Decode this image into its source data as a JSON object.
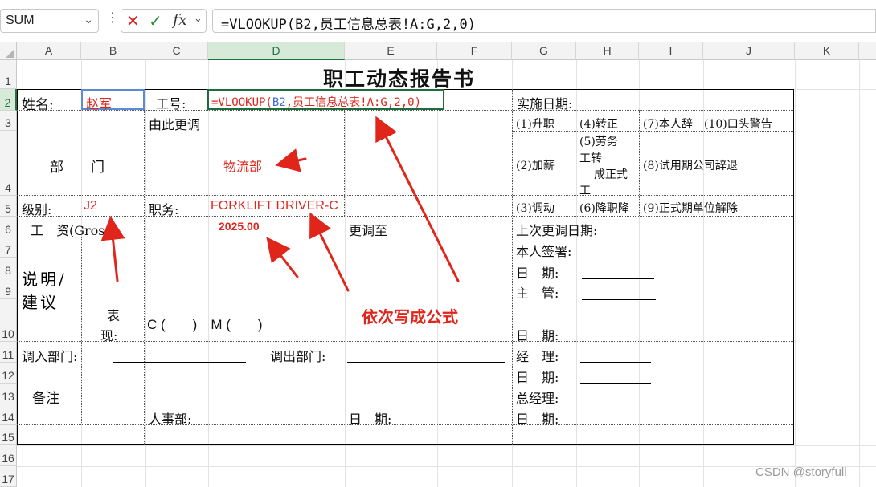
{
  "formula_bar": {
    "name_box": "SUM",
    "cancel_icon": "✕",
    "confirm_icon": "✓",
    "fx_label": "fx",
    "formula": "=VLOOKUP(B2,员工信息总表!A:G,2,0)"
  },
  "columns": [
    "A",
    "B",
    "C",
    "D",
    "E",
    "F",
    "G",
    "H",
    "I",
    "J",
    "K"
  ],
  "rows": [
    "1",
    "2",
    "3",
    "4",
    "5",
    "6",
    "7",
    "8",
    "9",
    "10",
    "11",
    "12",
    "13",
    "14",
    "15",
    "16",
    "17"
  ],
  "sheet": {
    "title": "职工动态报告书",
    "name_label": "姓名:",
    "name_value": "赵军",
    "id_label": "工号:",
    "cell_formula_prefix": "=VLOOKUP(",
    "cell_formula_ref": "B2",
    "cell_formula_rest": ",员工信息总表!A:G,2,0)",
    "effective_date": "实施日期:",
    "change_from": "由此更调",
    "dept_label": "部　　门",
    "dept_value": "物流部",
    "level_label": "级别:",
    "level_value": "J2",
    "position_label": "职务:",
    "position_value": "FORKLIFT DRIVER-C",
    "salary_label": "工　资(Gross)",
    "salary_value": "2025.00",
    "change_to": "更调至",
    "last_change": "上次更调日期:",
    "option1": "(1)升职",
    "option2": "(2)加薪",
    "option3": "(3)调动",
    "option4": "(4)转正",
    "option5a": "(5)劳务",
    "option5b": "工转",
    "option5c": "成正式",
    "option5d": "工",
    "option6": "(6)降职降",
    "option7": "(7)本人辞",
    "option8": "(8)试用期公司辞退",
    "option9": "(9)正式期单位解除",
    "option10": "(10)口头警告",
    "remark_label": "说明/建议",
    "perf_label_a": "表",
    "perf_label_b": "现:",
    "perf_c": "C (　　)　M (　　)",
    "signature": "本人签署:",
    "date1": "日　期:",
    "supervisor": "主　管:",
    "date2": "日　期:",
    "transfer_in": "调入部门:",
    "transfer_out": "调出部门:",
    "manager": "经　理:",
    "date3": "日　期:",
    "gm": "总经理:",
    "notes": "备注",
    "hr": "人事部:",
    "date4": "日　期:",
    "date5": "日　期:"
  },
  "annotation": "依次写成公式",
  "watermark": "CSDN @storyfull",
  "colors": {
    "accent_red": "#e0261b",
    "selection_green": "#217346"
  }
}
